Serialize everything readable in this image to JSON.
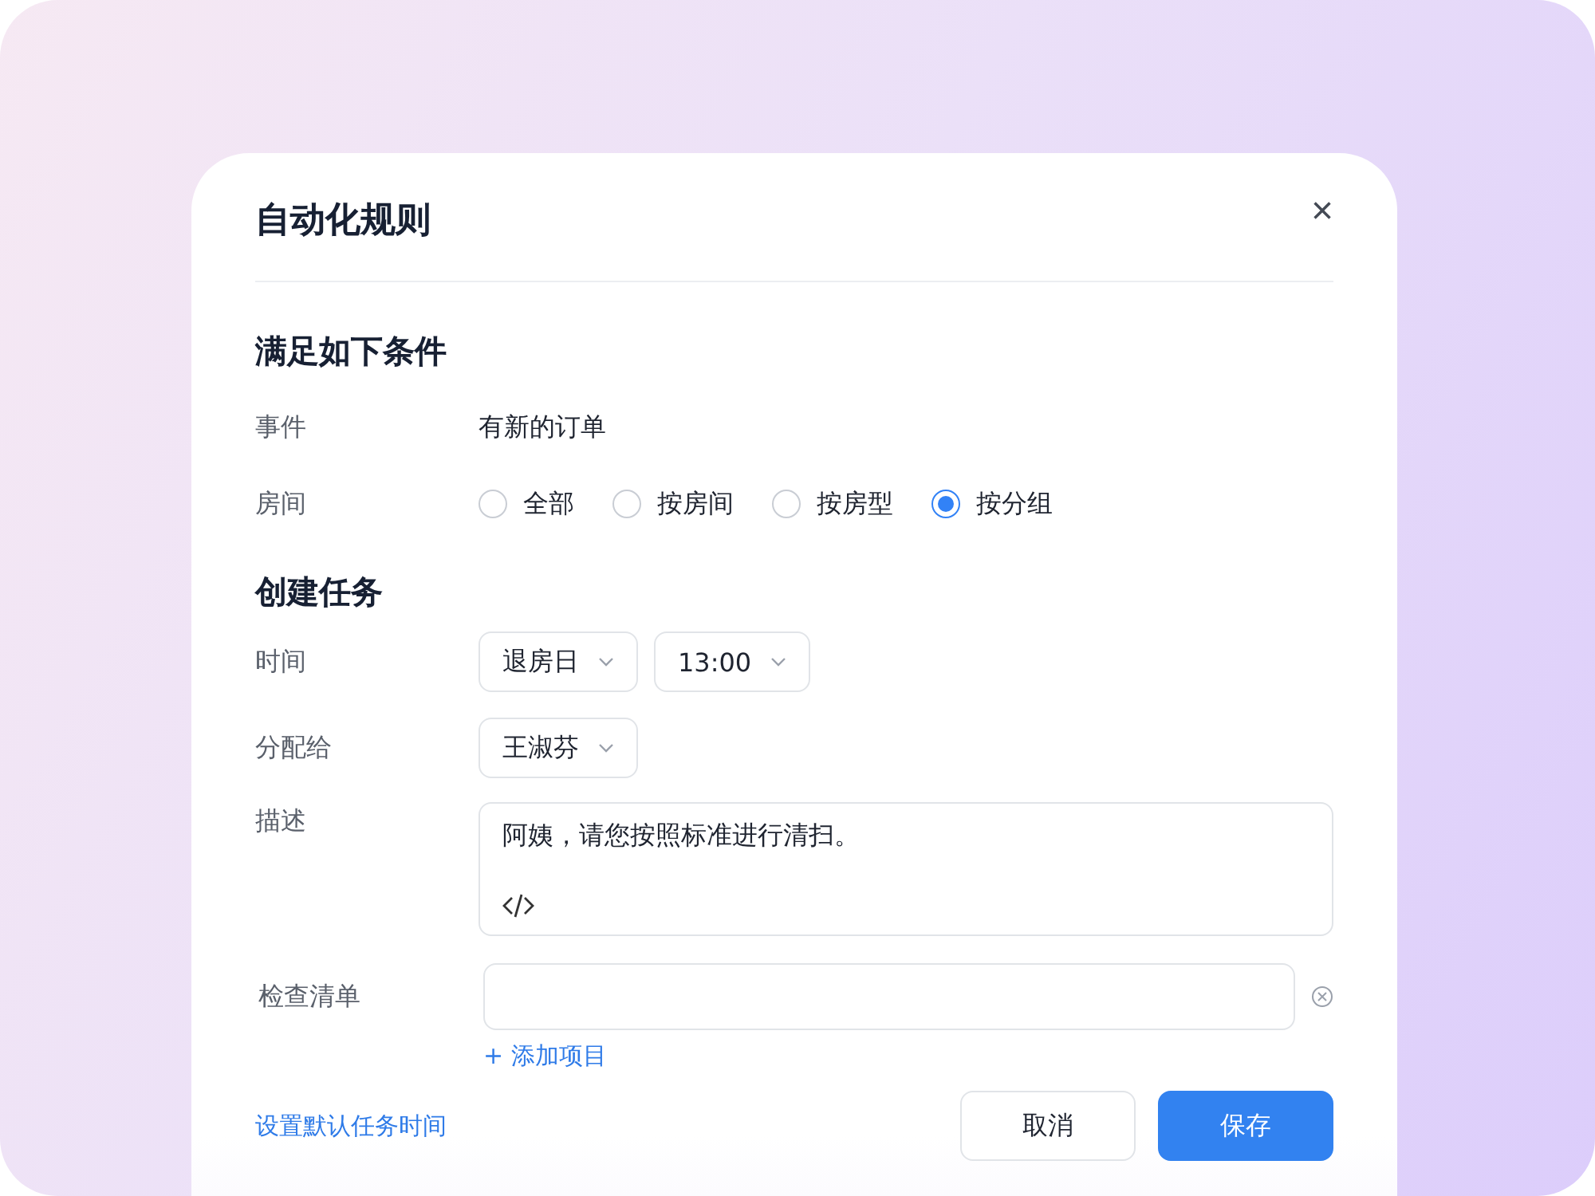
{
  "dialog": {
    "title": "自动化规则",
    "close": "×"
  },
  "conditions": {
    "heading": "满足如下条件",
    "event": {
      "label": "事件",
      "value": "有新的订单"
    },
    "room": {
      "label": "房间",
      "options": [
        {
          "label": "全部",
          "selected": false
        },
        {
          "label": "按房间",
          "selected": false
        },
        {
          "label": "按房型",
          "selected": false
        },
        {
          "label": "按分组",
          "selected": true
        }
      ]
    }
  },
  "task": {
    "heading": "创建任务",
    "time": {
      "label": "时间",
      "selects": [
        "退房日",
        "13:00"
      ]
    },
    "assignee": {
      "label": "分配给",
      "selects": [
        "王淑芬"
      ]
    },
    "description": {
      "label": "描述",
      "value": "阿姨，请您按照标准进行清扫。"
    },
    "checklist": {
      "label": "检查清单",
      "add": "+ 添加项目"
    }
  },
  "footer": {
    "link": "设置默认任务时间",
    "cancel": "取消",
    "save": "保存"
  }
}
